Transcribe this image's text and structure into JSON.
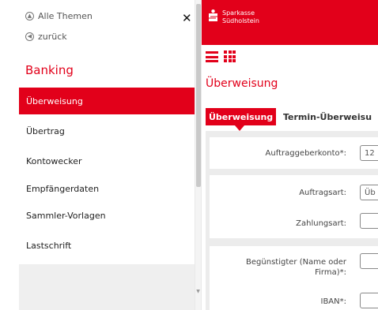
{
  "drawer": {
    "all_topics": "Alle Themen",
    "back": "zurück",
    "section_title": "Banking",
    "items": [
      {
        "label": "Überweisung",
        "active": true
      },
      {
        "label": "Übertrag",
        "active": false
      },
      {
        "label": "Kontowecker",
        "active": false
      },
      {
        "label": "Empfängerdaten",
        "active": false
      },
      {
        "label": "Sammler-Vorlagen",
        "active": false
      },
      {
        "label": "Lastschrift",
        "active": false
      }
    ]
  },
  "brand": {
    "line1": "Sparkasse",
    "line2": "Südholstein",
    "color": "#e2001a"
  },
  "main": {
    "page_title": "Überweisung",
    "tabs": [
      {
        "label": "Überweisung",
        "active": true
      },
      {
        "label": "Termin-Überweisu",
        "active": false
      }
    ],
    "fields": {
      "auftraggeberkonto": {
        "label": "Auftraggeberkonto*:",
        "value": "12"
      },
      "auftragsart": {
        "label": "Auftragsart:",
        "value": "Üb"
      },
      "zahlungsart": {
        "label": "Zahlungsart:",
        "value": ""
      },
      "beguenstigter": {
        "label_line1": "Begünstigter (Name oder",
        "label_line2": "Firma)*:",
        "value": ""
      },
      "iban": {
        "label": "IBAN*:",
        "value": ""
      }
    }
  },
  "icons": {
    "all_topics": "circle-chevron-up-icon",
    "back": "circle-chevron-left-icon",
    "close": "close-icon",
    "menu": "hamburger-icon",
    "apps": "grid-icon",
    "brand": "sparkasse-logo-icon"
  }
}
